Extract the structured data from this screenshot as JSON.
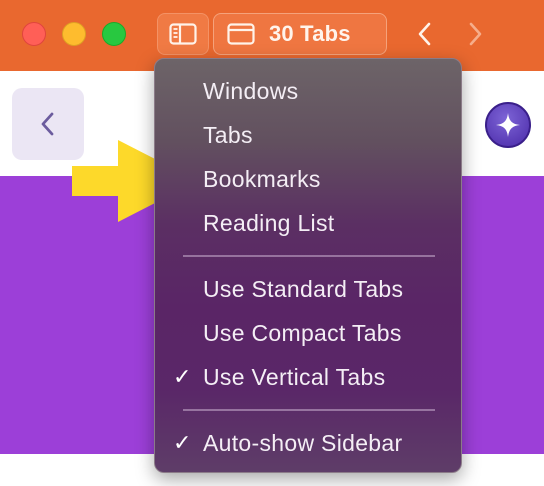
{
  "toolbar": {
    "tab_count_label": "30 Tabs",
    "colors": {
      "background": "#e9682f",
      "close": "#ff5f57",
      "minimize": "#febc2e",
      "zoom": "#28c840"
    }
  },
  "page": {
    "colors": {
      "band": "#9c3fd8"
    }
  },
  "menu": {
    "items": [
      {
        "label": "Windows",
        "checked": false
      },
      {
        "label": "Tabs",
        "checked": false
      },
      {
        "label": "Bookmarks",
        "checked": false
      },
      {
        "label": "Reading List",
        "checked": false
      }
    ],
    "tab_styles": [
      {
        "label": "Use Standard Tabs",
        "checked": false
      },
      {
        "label": "Use Compact Tabs",
        "checked": false
      },
      {
        "label": "Use Vertical Tabs",
        "checked": true,
        "check_mark": "✓"
      }
    ],
    "sidebar_options": [
      {
        "label": "Auto-show Sidebar",
        "checked": true,
        "check_mark": "✓"
      }
    ]
  },
  "annotation": {
    "arrow_color": "#fdd92a"
  }
}
